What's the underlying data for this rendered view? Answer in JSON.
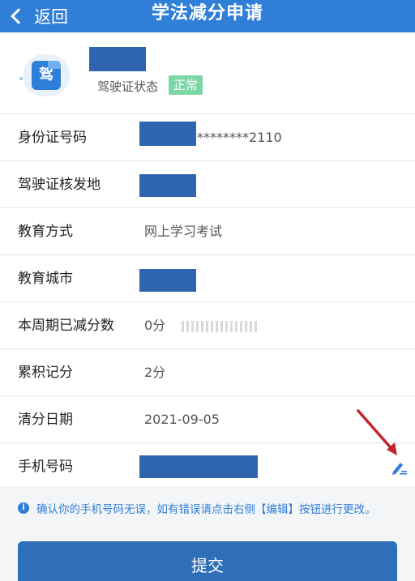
{
  "header": {
    "back_label": "返回",
    "title": "学法减分申请"
  },
  "profile": {
    "avatar_char": "驾",
    "status_label": "驾驶证状态",
    "status_badge": "正常"
  },
  "rows": [
    {
      "label": "身份证号码",
      "value": "********2110"
    },
    {
      "label": "驾驶证核发地",
      "value": ""
    },
    {
      "label": "教育方式",
      "value": "网上学习考试"
    },
    {
      "label": "教育城市",
      "value": ""
    },
    {
      "label": "本周期已减分数",
      "value": "0分"
    },
    {
      "label": "累积记分",
      "value": "2分"
    },
    {
      "label": "清分日期",
      "value": "2021-09-05"
    },
    {
      "label": "手机号码",
      "value": ""
    }
  ],
  "notice": {
    "icon": "i",
    "text": "确认你的手机号码无误，如有错误请点击右侧【编辑】按钮进行更改。"
  },
  "submit_label": "提交",
  "colors": {
    "primary": "#2f7ed8",
    "redaction": "#2f64b0",
    "status_badge": "#7cd6a6",
    "arrow": "#c0272d"
  }
}
